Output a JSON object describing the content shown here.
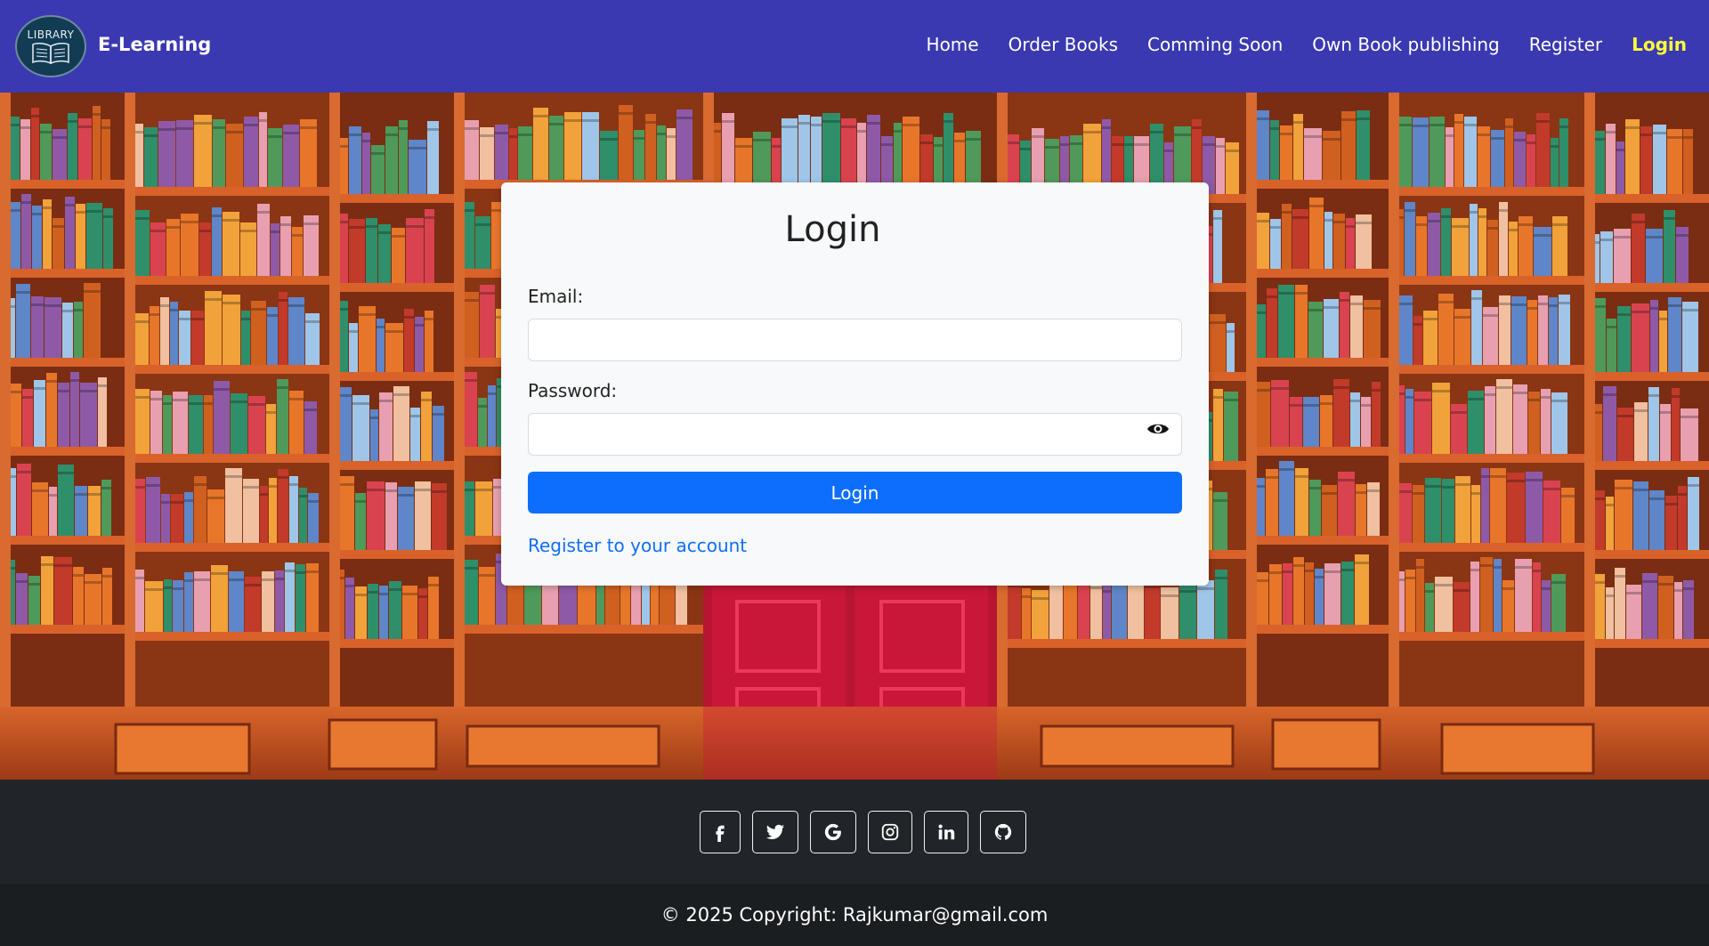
{
  "navbar": {
    "logo_text": "LIBRARY",
    "brand": "E-Learning",
    "links": [
      {
        "label": "Home"
      },
      {
        "label": "Order Books"
      },
      {
        "label": "Comming Soon"
      },
      {
        "label": "Own Book publishing"
      },
      {
        "label": "Register"
      },
      {
        "label": "Login",
        "active": true
      }
    ],
    "colors": {
      "background": "#3a39b1",
      "active_link": "#ffff3a"
    }
  },
  "login": {
    "title": "Login",
    "email_label": "Email:",
    "email_value": "",
    "password_label": "Password:",
    "password_value": "",
    "show_password_icon": "eye-icon",
    "submit_label": "Login",
    "register_link": "Register to your account",
    "colors": {
      "primary": "#0d6efd"
    }
  },
  "footer": {
    "socials": [
      {
        "icon": "facebook-icon"
      },
      {
        "icon": "twitter-icon"
      },
      {
        "icon": "google-icon"
      },
      {
        "icon": "instagram-icon"
      },
      {
        "icon": "linkedin-icon"
      },
      {
        "icon": "github-icon"
      }
    ],
    "copyright": "© 2025 Copyright: Rajkumar@gmail.com"
  }
}
